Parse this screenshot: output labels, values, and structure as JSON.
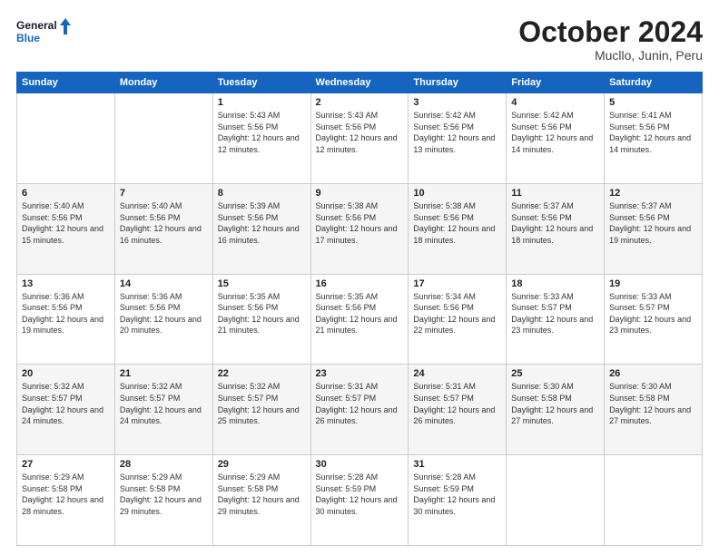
{
  "header": {
    "logo_general": "General",
    "logo_blue": "Blue",
    "month_title": "October 2024",
    "location": "Mucllo, Junin, Peru"
  },
  "weekdays": [
    "Sunday",
    "Monday",
    "Tuesday",
    "Wednesday",
    "Thursday",
    "Friday",
    "Saturday"
  ],
  "weeks": [
    [
      null,
      null,
      {
        "day": 1,
        "sunrise": "5:43 AM",
        "sunset": "5:56 PM",
        "daylight": "12 hours and 12 minutes."
      },
      {
        "day": 2,
        "sunrise": "5:43 AM",
        "sunset": "5:56 PM",
        "daylight": "12 hours and 12 minutes."
      },
      {
        "day": 3,
        "sunrise": "5:42 AM",
        "sunset": "5:56 PM",
        "daylight": "12 hours and 13 minutes."
      },
      {
        "day": 4,
        "sunrise": "5:42 AM",
        "sunset": "5:56 PM",
        "daylight": "12 hours and 14 minutes."
      },
      {
        "day": 5,
        "sunrise": "5:41 AM",
        "sunset": "5:56 PM",
        "daylight": "12 hours and 14 minutes."
      }
    ],
    [
      {
        "day": 6,
        "sunrise": "5:40 AM",
        "sunset": "5:56 PM",
        "daylight": "12 hours and 15 minutes."
      },
      {
        "day": 7,
        "sunrise": "5:40 AM",
        "sunset": "5:56 PM",
        "daylight": "12 hours and 16 minutes."
      },
      {
        "day": 8,
        "sunrise": "5:39 AM",
        "sunset": "5:56 PM",
        "daylight": "12 hours and 16 minutes."
      },
      {
        "day": 9,
        "sunrise": "5:38 AM",
        "sunset": "5:56 PM",
        "daylight": "12 hours and 17 minutes."
      },
      {
        "day": 10,
        "sunrise": "5:38 AM",
        "sunset": "5:56 PM",
        "daylight": "12 hours and 18 minutes."
      },
      {
        "day": 11,
        "sunrise": "5:37 AM",
        "sunset": "5:56 PM",
        "daylight": "12 hours and 18 minutes."
      },
      {
        "day": 12,
        "sunrise": "5:37 AM",
        "sunset": "5:56 PM",
        "daylight": "12 hours and 19 minutes."
      }
    ],
    [
      {
        "day": 13,
        "sunrise": "5:36 AM",
        "sunset": "5:56 PM",
        "daylight": "12 hours and 19 minutes."
      },
      {
        "day": 14,
        "sunrise": "5:36 AM",
        "sunset": "5:56 PM",
        "daylight": "12 hours and 20 minutes."
      },
      {
        "day": 15,
        "sunrise": "5:35 AM",
        "sunset": "5:56 PM",
        "daylight": "12 hours and 21 minutes."
      },
      {
        "day": 16,
        "sunrise": "5:35 AM",
        "sunset": "5:56 PM",
        "daylight": "12 hours and 21 minutes."
      },
      {
        "day": 17,
        "sunrise": "5:34 AM",
        "sunset": "5:56 PM",
        "daylight": "12 hours and 22 minutes."
      },
      {
        "day": 18,
        "sunrise": "5:33 AM",
        "sunset": "5:57 PM",
        "daylight": "12 hours and 23 minutes."
      },
      {
        "day": 19,
        "sunrise": "5:33 AM",
        "sunset": "5:57 PM",
        "daylight": "12 hours and 23 minutes."
      }
    ],
    [
      {
        "day": 20,
        "sunrise": "5:32 AM",
        "sunset": "5:57 PM",
        "daylight": "12 hours and 24 minutes."
      },
      {
        "day": 21,
        "sunrise": "5:32 AM",
        "sunset": "5:57 PM",
        "daylight": "12 hours and 24 minutes."
      },
      {
        "day": 22,
        "sunrise": "5:32 AM",
        "sunset": "5:57 PM",
        "daylight": "12 hours and 25 minutes."
      },
      {
        "day": 23,
        "sunrise": "5:31 AM",
        "sunset": "5:57 PM",
        "daylight": "12 hours and 26 minutes."
      },
      {
        "day": 24,
        "sunrise": "5:31 AM",
        "sunset": "5:57 PM",
        "daylight": "12 hours and 26 minutes."
      },
      {
        "day": 25,
        "sunrise": "5:30 AM",
        "sunset": "5:58 PM",
        "daylight": "12 hours and 27 minutes."
      },
      {
        "day": 26,
        "sunrise": "5:30 AM",
        "sunset": "5:58 PM",
        "daylight": "12 hours and 27 minutes."
      }
    ],
    [
      {
        "day": 27,
        "sunrise": "5:29 AM",
        "sunset": "5:58 PM",
        "daylight": "12 hours and 28 minutes."
      },
      {
        "day": 28,
        "sunrise": "5:29 AM",
        "sunset": "5:58 PM",
        "daylight": "12 hours and 29 minutes."
      },
      {
        "day": 29,
        "sunrise": "5:29 AM",
        "sunset": "5:58 PM",
        "daylight": "12 hours and 29 minutes."
      },
      {
        "day": 30,
        "sunrise": "5:28 AM",
        "sunset": "5:59 PM",
        "daylight": "12 hours and 30 minutes."
      },
      {
        "day": 31,
        "sunrise": "5:28 AM",
        "sunset": "5:59 PM",
        "daylight": "12 hours and 30 minutes."
      },
      null,
      null
    ]
  ],
  "labels": {
    "sunrise_prefix": "Sunrise: ",
    "sunset_prefix": "Sunset: ",
    "daylight_prefix": "Daylight: "
  }
}
